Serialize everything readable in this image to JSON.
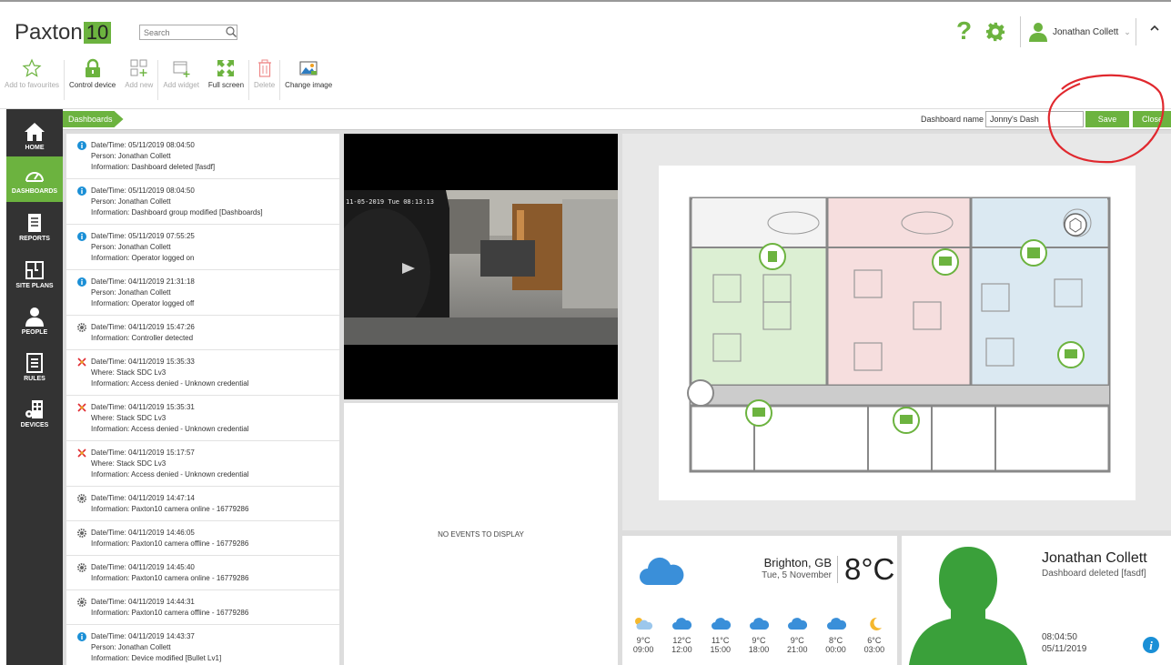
{
  "app": {
    "logo_text": "Paxton",
    "logo_number": "10"
  },
  "search": {
    "placeholder": "Search"
  },
  "user": {
    "name": "Jonathan Collett"
  },
  "ribbon": [
    {
      "label": "Add to favourites",
      "icon": "star-icon",
      "enabled": false
    },
    {
      "label": "Control device",
      "icon": "padlock-icon",
      "enabled": true
    },
    {
      "label": "Add new",
      "icon": "add-grid-icon",
      "enabled": false
    },
    {
      "label": "Add widget",
      "icon": "add-widget-icon",
      "enabled": false
    },
    {
      "label": "Full screen",
      "icon": "fullscreen-icon",
      "enabled": true
    },
    {
      "label": "Delete",
      "icon": "trash-icon",
      "enabled": false
    },
    {
      "label": "Change image",
      "icon": "image-icon",
      "enabled": true
    }
  ],
  "nav": [
    {
      "label": "HOME",
      "icon": "home-icon",
      "active": false
    },
    {
      "label": "DASHBOARDS",
      "icon": "gauge-icon",
      "active": true
    },
    {
      "label": "REPORTS",
      "icon": "report-icon",
      "active": false
    },
    {
      "label": "SITE PLANS",
      "icon": "site-plan-icon",
      "active": false
    },
    {
      "label": "PEOPLE",
      "icon": "person-icon",
      "active": false
    },
    {
      "label": "RULES",
      "icon": "rules-icon",
      "active": false
    },
    {
      "label": "DEVICES",
      "icon": "devices-icon",
      "active": false
    }
  ],
  "breadcrumb": {
    "label": "Dashboards"
  },
  "dashboard": {
    "name_label": "Dashboard name",
    "name_value": "Jonny's Dash",
    "save_label": "Save",
    "close_label": "Close"
  },
  "events": [
    {
      "icon": "info-icon",
      "lines": [
        "Date/Time: 05/11/2019 08:04:50",
        "Person: Jonathan Collett",
        "Information: Dashboard deleted [fasdf]"
      ]
    },
    {
      "icon": "info-icon",
      "lines": [
        "Date/Time: 05/11/2019 08:04:50",
        "Person: Jonathan Collett",
        "Information: Dashboard group modified [Dashboards]"
      ]
    },
    {
      "icon": "info-icon",
      "lines": [
        "Date/Time: 05/11/2019 07:55:25",
        "Person: Jonathan Collett",
        "Information: Operator logged on"
      ]
    },
    {
      "icon": "info-icon",
      "lines": [
        "Date/Time: 04/11/2019 21:31:18",
        "Person: Jonathan Collett",
        "Information: Operator logged off"
      ]
    },
    {
      "icon": "cog-icon",
      "lines": [
        "Date/Time: 04/11/2019 15:47:26",
        "Information: Controller detected"
      ]
    },
    {
      "icon": "access-denied-icon",
      "lines": [
        "Date/Time: 04/11/2019 15:35:33",
        "Where: Stack SDC Lv3",
        "Information: Access denied - Unknown credential"
      ]
    },
    {
      "icon": "access-denied-icon",
      "lines": [
        "Date/Time: 04/11/2019 15:35:31",
        "Where: Stack SDC Lv3",
        "Information: Access denied - Unknown credential"
      ]
    },
    {
      "icon": "access-denied-icon",
      "lines": [
        "Date/Time: 04/11/2019 15:17:57",
        "Where: Stack SDC Lv3",
        "Information: Access denied - Unknown credential"
      ]
    },
    {
      "icon": "cog-icon",
      "lines": [
        "Date/Time: 04/11/2019 14:47:14",
        "Information: Paxton10 camera online - 16779286"
      ]
    },
    {
      "icon": "cog-icon",
      "lines": [
        "Date/Time: 04/11/2019 14:46:05",
        "Information: Paxton10 camera offline - 16779286"
      ]
    },
    {
      "icon": "cog-icon",
      "lines": [
        "Date/Time: 04/11/2019 14:45:40",
        "Information: Paxton10 camera online - 16779286"
      ]
    },
    {
      "icon": "cog-icon",
      "lines": [
        "Date/Time: 04/11/2019 14:44:31",
        "Information: Paxton10 camera offline - 16779286"
      ]
    },
    {
      "icon": "info-icon",
      "lines": [
        "Date/Time: 04/11/2019 14:43:37",
        "Person: Jonathan Collett",
        "Information: Device modified [Bullet Lv1]"
      ]
    }
  ],
  "camera": {
    "timestamp": "11-05-2019 Tue 08:13:13"
  },
  "no_events": {
    "text": "NO EVENTS TO DISPLAY"
  },
  "weather": {
    "city": "Brighton, GB",
    "date": "Tue, 5 November",
    "temp": "8°C",
    "icon": "cloud-icon",
    "forecast": [
      {
        "temp": "9°C",
        "time": "09:00",
        "icon": "sun-cloud-icon"
      },
      {
        "temp": "12°C",
        "time": "12:00",
        "icon": "cloud-icon"
      },
      {
        "temp": "11°C",
        "time": "15:00",
        "icon": "cloud-icon"
      },
      {
        "temp": "9°C",
        "time": "18:00",
        "icon": "cloud-icon"
      },
      {
        "temp": "9°C",
        "time": "21:00",
        "icon": "cloud-icon"
      },
      {
        "temp": "8°C",
        "time": "00:00",
        "icon": "cloud-icon"
      },
      {
        "temp": "6°C",
        "time": "03:00",
        "icon": "moon-icon"
      }
    ]
  },
  "person": {
    "name": "Jonathan Collett",
    "info": "Dashboard deleted [fasdf]",
    "time": "08:04:50",
    "date": "05/11/2019"
  },
  "colors": {
    "accent": "#6cb33f",
    "sidebar": "#333333",
    "info": "#1a8fd6",
    "annotation": "#e0282e"
  }
}
